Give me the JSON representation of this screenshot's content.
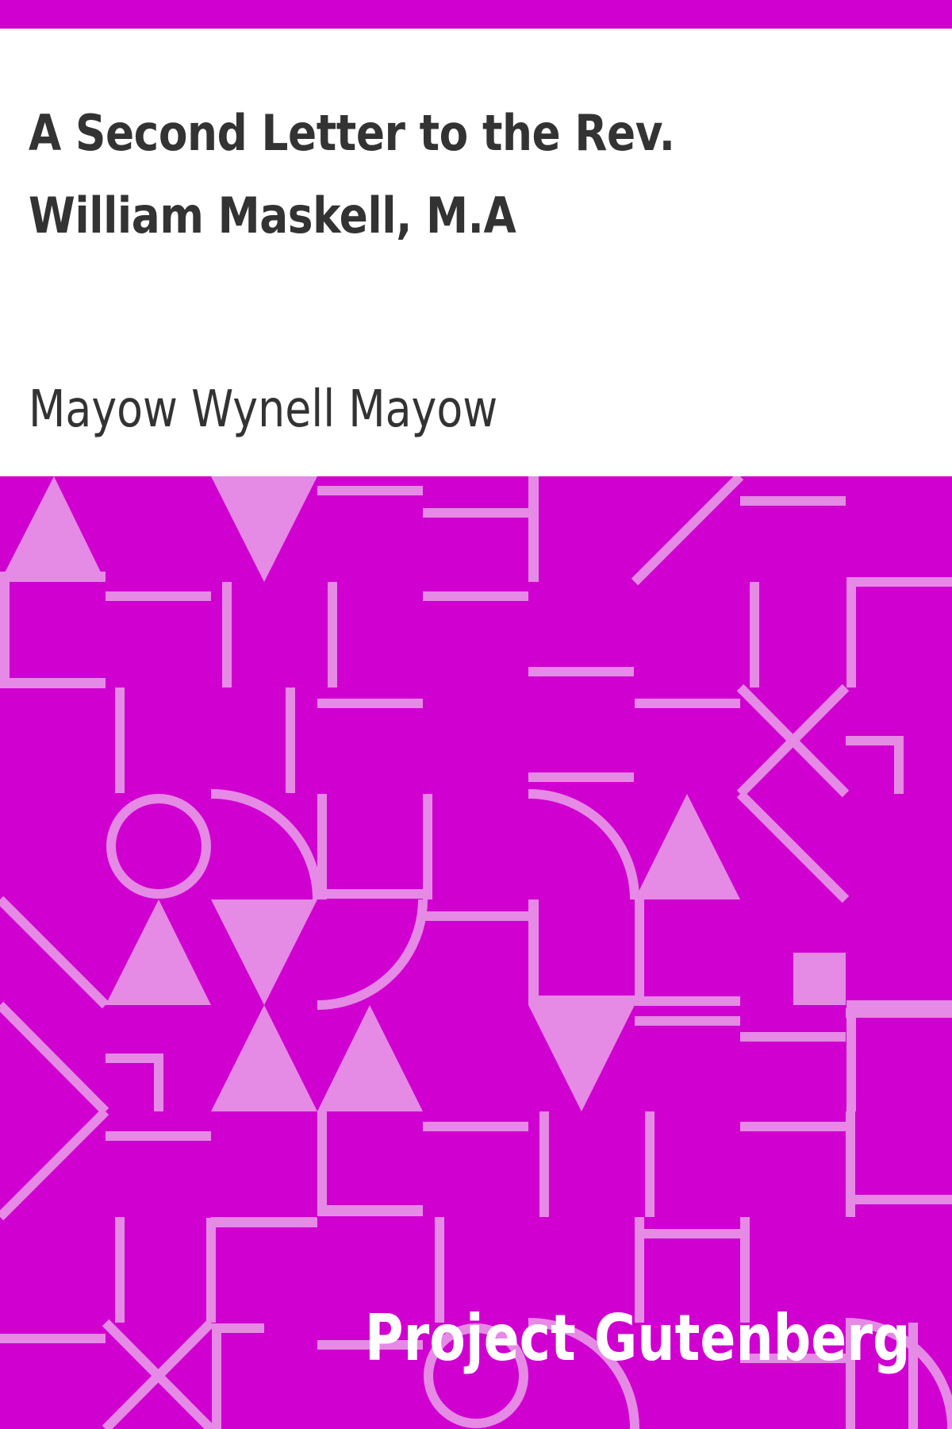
{
  "book": {
    "title": "A Second Letter to the Rev. William Maskell, M.A",
    "author": "Mayow Wynell Mayow",
    "publisher": "Project Gutenberg"
  },
  "colors": {
    "background": "#d000d0",
    "pattern": "#e58ae5",
    "text": "#333333",
    "publisher_text": "#ffffff"
  }
}
